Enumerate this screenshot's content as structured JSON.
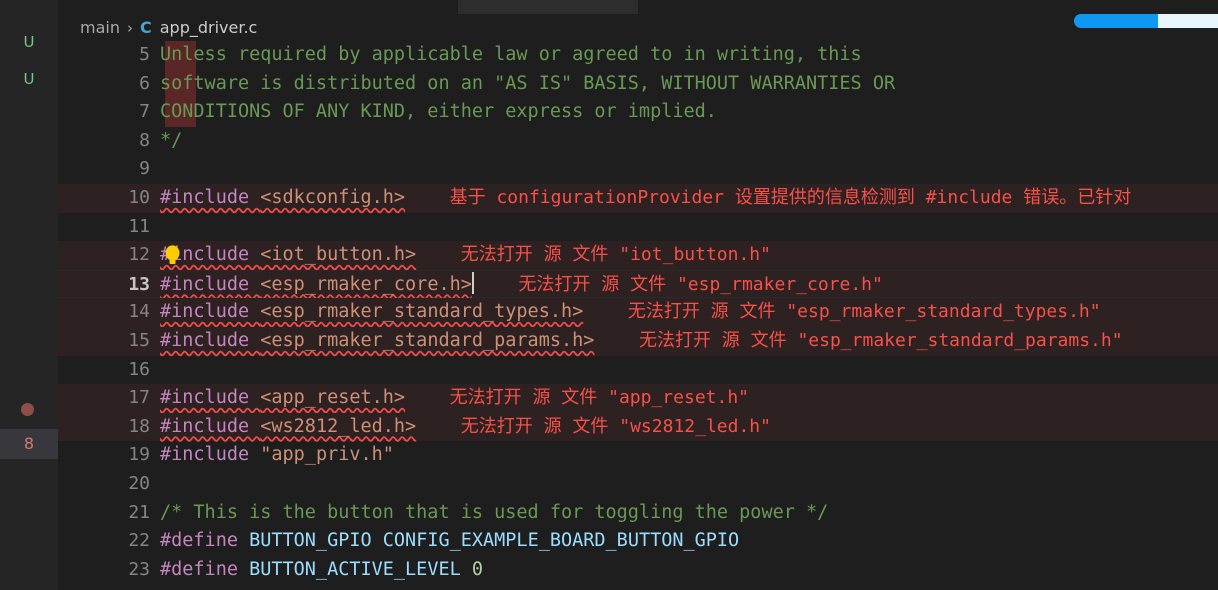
{
  "window": {
    "background": "#1e1e1e",
    "accent": "#0d99f2"
  },
  "explorer": {
    "badges": [
      {
        "label": "U",
        "color": "#73c991"
      },
      {
        "label": "U",
        "color": "#73c991"
      }
    ],
    "gutter_marker_icon": "breakpoint-dot",
    "gutter_count": "8"
  },
  "breadcrumb": {
    "root": "main",
    "separator": "›",
    "file_icon": "C",
    "file": "app_driver.c"
  },
  "editor": {
    "language": "c",
    "active_line": 13,
    "quickfix_icon": "lightbulb-icon",
    "lines": [
      {
        "num": "5",
        "error": false,
        "block_marker": true,
        "tokens": [
          {
            "t": "Unless required by applicable law or agreed to in writing, this",
            "c": "c-comment"
          }
        ],
        "diag": ""
      },
      {
        "num": "6",
        "error": false,
        "tokens": [
          {
            "t": "software is distributed on an \"AS IS\" BASIS, WITHOUT WARRANTIES OR",
            "c": "c-comment"
          }
        ],
        "diag": ""
      },
      {
        "num": "7",
        "error": false,
        "tokens": [
          {
            "t": "CONDITIONS OF ANY KIND, either express or implied.",
            "c": "c-comment"
          }
        ],
        "diag": ""
      },
      {
        "num": "8",
        "error": false,
        "indent": 0,
        "tokens": [
          {
            "t": "*/",
            "c": "c-comment"
          }
        ],
        "diag": ""
      },
      {
        "num": "9",
        "error": false,
        "tokens": [],
        "diag": ""
      },
      {
        "num": "10",
        "error": true,
        "tokens": [
          {
            "t": "#include ",
            "c": "c-macro",
            "sq": true
          },
          {
            "t": "<sdkconfig.h>",
            "c": "c-header",
            "sq": true
          }
        ],
        "diag": "基于 configurationProvider 设置提供的信息检测到 #include 错误。已针对"
      },
      {
        "num": "11",
        "error": false,
        "tokens": [],
        "diag": ""
      },
      {
        "num": "12",
        "error": true,
        "lightbulb": true,
        "tokens": [
          {
            "t": "#include ",
            "c": "c-macro",
            "sq": true
          },
          {
            "t": "<iot_button.h>",
            "c": "c-header",
            "sq": true
          }
        ],
        "diag": "无法打开 源 文件 \"iot_button.h\""
      },
      {
        "num": "13",
        "error": true,
        "active": true,
        "caret": true,
        "tokens": [
          {
            "t": "#include ",
            "c": "c-macro",
            "sq": true
          },
          {
            "t": "<esp_rmaker_core.h>",
            "c": "c-header",
            "sq": true
          }
        ],
        "diag": "无法打开 源 文件 \"esp_rmaker_core.h\""
      },
      {
        "num": "14",
        "error": true,
        "tokens": [
          {
            "t": "#include ",
            "c": "c-macro",
            "sq": true
          },
          {
            "t": "<esp_rmaker_standard_types.h>",
            "c": "c-header",
            "sq": true
          }
        ],
        "diag": "无法打开 源 文件 \"esp_rmaker_standard_types.h\""
      },
      {
        "num": "15",
        "error": true,
        "tokens": [
          {
            "t": "#include ",
            "c": "c-macro",
            "sq": true
          },
          {
            "t": "<esp_rmaker_standard_params.h>",
            "c": "c-header",
            "sq": true
          }
        ],
        "diag": "无法打开 源 文件 \"esp_rmaker_standard_params.h\""
      },
      {
        "num": "16",
        "error": false,
        "tokens": [],
        "diag": ""
      },
      {
        "num": "17",
        "error": true,
        "tokens": [
          {
            "t": "#include ",
            "c": "c-macro",
            "sq": true
          },
          {
            "t": "<app_reset.h>",
            "c": "c-header",
            "sq": true
          }
        ],
        "diag": "无法打开 源 文件 \"app_reset.h\""
      },
      {
        "num": "18",
        "error": true,
        "tokens": [
          {
            "t": "#include ",
            "c": "c-macro",
            "sq": true
          },
          {
            "t": "<ws2812_led.h>",
            "c": "c-header",
            "sq": true
          }
        ],
        "diag": "无法打开 源 文件 \"ws2812_led.h\""
      },
      {
        "num": "19",
        "error": false,
        "tokens": [
          {
            "t": "#include ",
            "c": "c-macro"
          },
          {
            "t": "\"app_priv.h\"",
            "c": "c-string"
          }
        ],
        "diag": ""
      },
      {
        "num": "20",
        "error": false,
        "tokens": [],
        "diag": ""
      },
      {
        "num": "21",
        "error": false,
        "tokens": [
          {
            "t": "/* This is the button that is used for toggling the power */",
            "c": "c-comment"
          }
        ],
        "diag": ""
      },
      {
        "num": "22",
        "error": false,
        "tokens": [
          {
            "t": "#define ",
            "c": "c-macro"
          },
          {
            "t": "BUTTON_GPIO",
            "c": "c-ident"
          },
          {
            "t": "          ",
            "c": "c-plain"
          },
          {
            "t": "CONFIG_EXAMPLE_BOARD_BUTTON_GPIO",
            "c": "c-ident"
          }
        ],
        "diag": ""
      },
      {
        "num": "23",
        "error": false,
        "tokens": [
          {
            "t": "#define ",
            "c": "c-macro"
          },
          {
            "t": "BUTTON_ACTIVE_LEVEL",
            "c": "c-ident"
          },
          {
            "t": "  ",
            "c": "c-plain"
          },
          {
            "t": "0",
            "c": "c-number"
          }
        ],
        "diag": ""
      }
    ]
  }
}
